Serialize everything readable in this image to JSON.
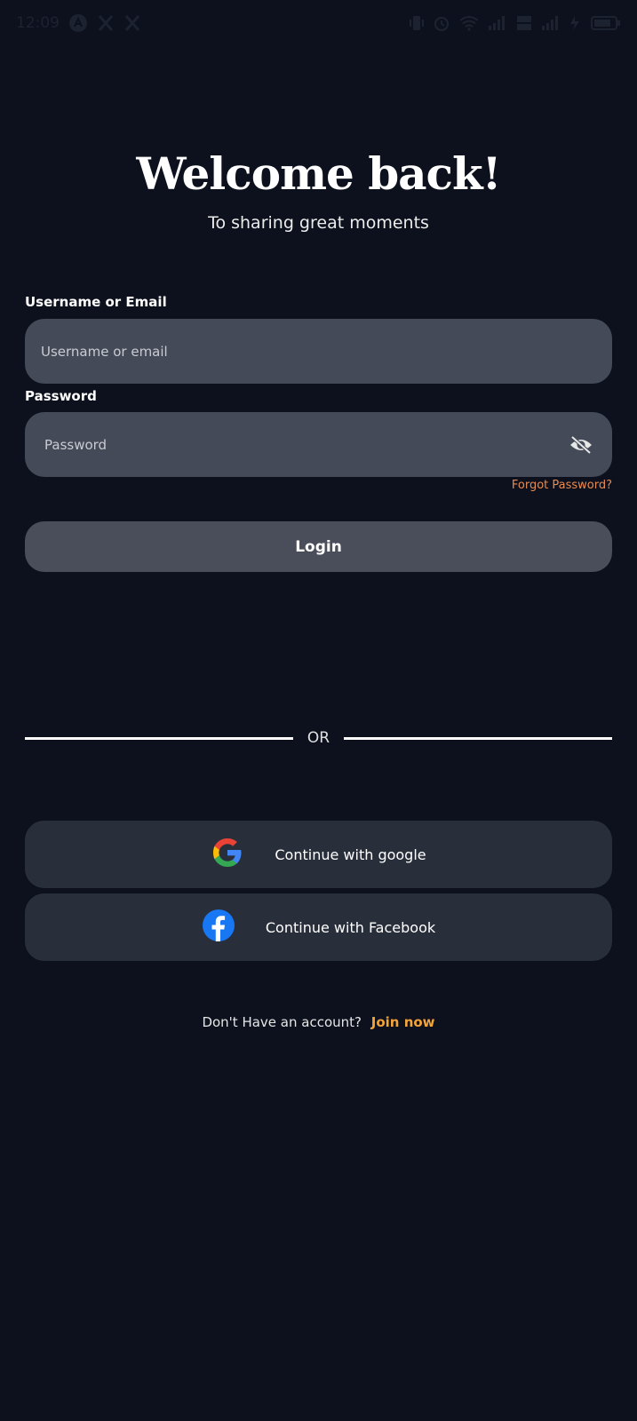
{
  "status_bar": {
    "time": "12:09",
    "left_icons": [
      "assistant-icon",
      "x-logo-icon",
      "x-logo-icon"
    ],
    "right_icons": [
      "vibrate-icon",
      "alarm-icon",
      "wifi-icon",
      "signal-icon",
      "volte-icon",
      "signal-icon",
      "battery-saver-icon",
      "battery-icon"
    ]
  },
  "header": {
    "title": "Welcome back!",
    "subtitle": "To sharing great moments"
  },
  "form": {
    "username_label": "Username or Email",
    "username_placeholder": "Username or email",
    "username_value": "",
    "password_label": "Password",
    "password_placeholder": "Password",
    "password_value": "",
    "password_toggle_icon": "eye-off-icon",
    "forgot_label": "Forgot Password?",
    "login_label": "Login"
  },
  "divider": {
    "text": "OR"
  },
  "social": {
    "google_label": "Continue with google",
    "google_icon": "google-icon",
    "facebook_label": "Continue with Facebook",
    "facebook_icon": "facebook-icon"
  },
  "signup": {
    "question": "Don't Have an account?",
    "join_label": "Join now"
  },
  "colors": {
    "background": "#0c111d",
    "input_bg": "#454a58",
    "button_bg": "#4a4e5a",
    "social_bg": "#292e3b",
    "forgot": "#e88b52",
    "join": "#f2a33a",
    "facebook_blue": "#1877f2"
  }
}
